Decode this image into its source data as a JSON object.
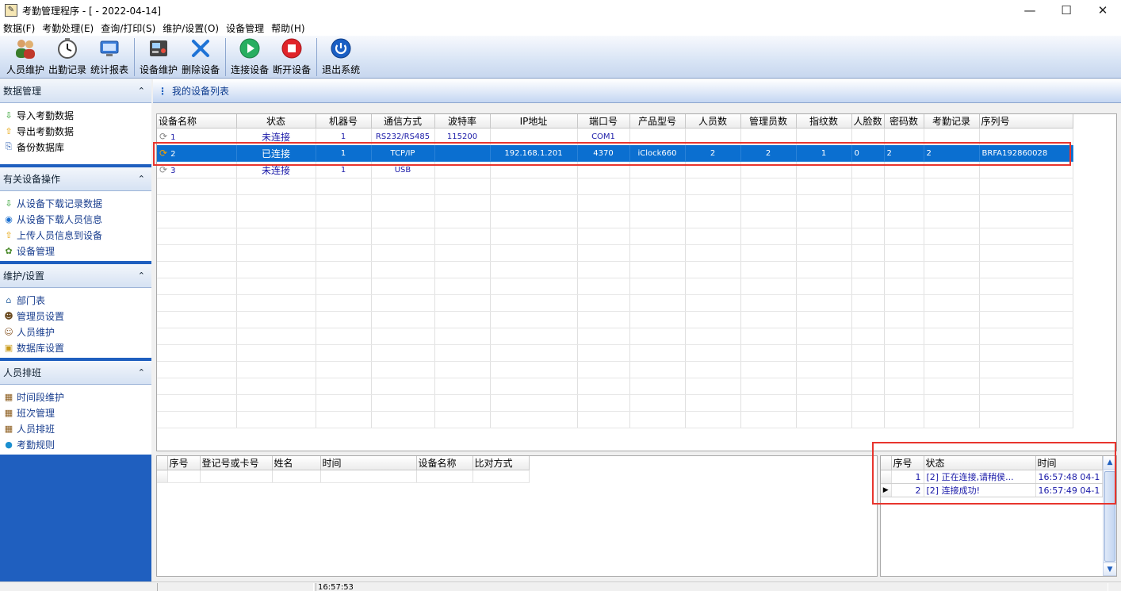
{
  "window": {
    "title": "考勤管理程序 - [ - 2022-04-14]",
    "minimize": "—",
    "maximize": "☐",
    "close": "✕"
  },
  "menu": [
    "数据(F)",
    "考勤处理(E)",
    "查询/打印(S)",
    "维护/设置(O)",
    "设备管理",
    "帮助(H)"
  ],
  "toolbar": {
    "group1": [
      {
        "label": "人员维护",
        "icon": "people-icon"
      },
      {
        "label": "出勤记录",
        "icon": "clock-icon"
      },
      {
        "label": "统计报表",
        "icon": "monitor-icon"
      }
    ],
    "group2": [
      {
        "label": "设备维护",
        "icon": "device-icon"
      },
      {
        "label": "删除设备",
        "icon": "delete-x-icon"
      }
    ],
    "group3": [
      {
        "label": "连接设备",
        "icon": "play-icon"
      },
      {
        "label": "断开设备",
        "icon": "stop-icon"
      }
    ],
    "group4": [
      {
        "label": "退出系统",
        "icon": "power-icon"
      }
    ]
  },
  "sidebar": {
    "sections": [
      {
        "title": "数据管理",
        "items": [
          {
            "label": "导入考勤数据",
            "icon": "arrow-down-icon"
          },
          {
            "label": "导出考勤数据",
            "icon": "arrow-up-icon"
          },
          {
            "label": "备份数据库",
            "icon": "backup-icon"
          }
        ]
      },
      {
        "title": "有关设备操作",
        "items": [
          {
            "label": "从设备下载记录数据",
            "icon": "arrow-down-icon"
          },
          {
            "label": "从设备下载人员信息",
            "icon": "globe-icon"
          },
          {
            "label": "上传人员信息到设备",
            "icon": "arrow-up-icon"
          },
          {
            "label": "设备管理",
            "icon": "device-manage-icon"
          }
        ]
      },
      {
        "title": "维护/设置",
        "items": [
          {
            "label": "部门表",
            "icon": "house-icon"
          },
          {
            "label": "管理员设置",
            "icon": "admin-icon"
          },
          {
            "label": "人员维护",
            "icon": "people-icon"
          },
          {
            "label": "数据库设置",
            "icon": "lock-icon"
          }
        ]
      },
      {
        "title": "人员排班",
        "items": [
          {
            "label": "时间段维护",
            "icon": "film-icon"
          },
          {
            "label": "班次管理",
            "icon": "film-icon"
          },
          {
            "label": "人员排班",
            "icon": "film-icon"
          },
          {
            "label": "考勤规则",
            "icon": "dot-icon"
          }
        ]
      }
    ],
    "collapse_glyph": "⌃"
  },
  "main": {
    "title": "我的设备列表",
    "columns": [
      "设备名称",
      "状态",
      "机器号",
      "通信方式",
      "波特率",
      "IP地址",
      "端口号",
      "产品型号",
      "人员数",
      "管理员数",
      "指纹数",
      "人脸数",
      "密码数",
      "考勤记录",
      "序列号"
    ],
    "rows": [
      {
        "name": "1",
        "status": "未连接",
        "machine": "1",
        "comm": "RS232/RS485",
        "baud": "115200",
        "ip": "",
        "port": "COM1",
        "model": "",
        "users": "",
        "admins": "",
        "fp": "",
        "face": "",
        "pwd": "",
        "records": "",
        "serial": "",
        "selected": false
      },
      {
        "name": "2",
        "status": "已连接",
        "machine": "1",
        "comm": "TCP/IP",
        "baud": "",
        "ip": "192.168.1.201",
        "port": "4370",
        "model": "iClock660",
        "users": "2",
        "admins": "2",
        "fp": "1",
        "face": "0",
        "pwd": "2",
        "records": "2",
        "serial": "BRFA192860028",
        "selected": true
      },
      {
        "name": "3",
        "status": "未连接",
        "machine": "1",
        "comm": "USB",
        "baud": "",
        "ip": "",
        "port": "",
        "model": "",
        "users": "",
        "admins": "",
        "fp": "",
        "face": "",
        "pwd": "",
        "records": "",
        "serial": "",
        "selected": false
      }
    ]
  },
  "records_panel": {
    "columns": [
      "序号",
      "登记号或卡号",
      "姓名",
      "时间",
      "设备名称",
      "比对方式"
    ]
  },
  "log_panel": {
    "columns": [
      "序号",
      "状态",
      "时间"
    ],
    "rows": [
      {
        "no": "1",
        "status": "[2] 正在连接,请稍侯...",
        "time": "16:57:48 04-1"
      },
      {
        "no": "2",
        "status": "[2] 连接成功!",
        "time": "16:57:49 04-1"
      }
    ]
  },
  "statusbar": {
    "time": "16:57:53"
  },
  "colors": {
    "sidebar_bg": "#1f5fbf",
    "selection": "#0b6fd0",
    "highlight_box": "#e8352e",
    "cell_text": "#1a1aa8"
  }
}
